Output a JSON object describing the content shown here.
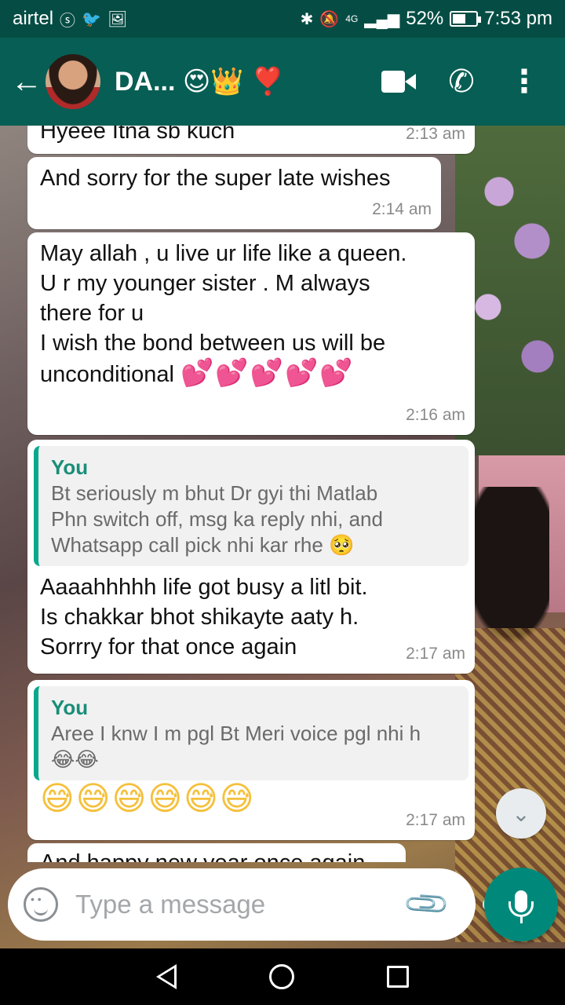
{
  "status_bar": {
    "carrier": "airtel",
    "network": "4G",
    "battery": "52%",
    "time": "7:53 pm"
  },
  "header": {
    "contact_name": "DA... 😍👑 ❣️"
  },
  "messages": [
    {
      "text": "Hyeee Itna sb kuch",
      "time": "2:13 am"
    },
    {
      "text": "And sorry for the super late wishes",
      "time": "2:14 am"
    },
    {
      "text": "May allah , u live ur life like a queen.\nU r my younger sister . M always\nthere for u\nI wish the bond between us will be\nunconditional",
      "emoji": "💕💕💕💕💕",
      "time": "2:16 am"
    },
    {
      "quote": {
        "author": "You",
        "text": "Bt seriously m bhut Dr gyi thi Matlab\nPhn switch off, msg ka reply nhi, and\nWhatsapp call pick nhi kar rhe 🥺"
      },
      "text": "Aaaahhhhh life got busy a litl bit.\nIs chakkar bhot shikayte aaty h.\nSorrry for that once again",
      "time": "2:17 am"
    },
    {
      "quote": {
        "author": "You",
        "text": "Aree I knw I m pgl Bt Meri voice pgl nhi h\n😂😂"
      },
      "emoji": "😅😅😅😅😅😅",
      "time": "2:17 am"
    },
    {
      "text": "And happy new year once again"
    }
  ],
  "input": {
    "placeholder": "Type a message"
  },
  "colors": {
    "header": "#075e54",
    "status_bar": "#054d44",
    "accent": "#00897b",
    "quote_author": "#1a8e78"
  }
}
